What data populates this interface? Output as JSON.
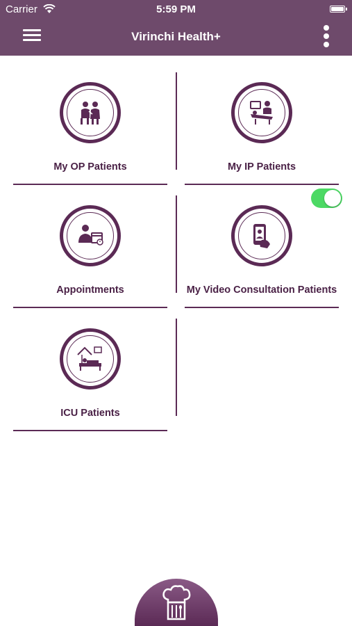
{
  "status_bar": {
    "carrier": "Carrier",
    "time": "5:59 PM"
  },
  "nav": {
    "title": "Virinchi Health+",
    "menu_icon": "hamburger-menu-icon",
    "more_icon": "more-vertical-icon"
  },
  "tiles": [
    {
      "label": "My OP Patients",
      "icon": "doctor-patient-icon"
    },
    {
      "label": "My IP Patients",
      "icon": "hospital-bed-icon"
    },
    {
      "label": "Appointments",
      "icon": "appointment-calendar-icon"
    },
    {
      "label": "My Video Consultation Patients",
      "icon": "video-call-phone-icon"
    },
    {
      "label": "ICU Patients",
      "icon": "icu-bed-icon"
    }
  ],
  "video_toggle": {
    "on": true
  },
  "bottom_button": {
    "icon": "chef-hat-cutlery-icon"
  },
  "colors": {
    "primary": "#6e4a6b",
    "accent_dark": "#5b2a55",
    "label_text": "#4a2146",
    "toggle_on": "#4cd964"
  }
}
